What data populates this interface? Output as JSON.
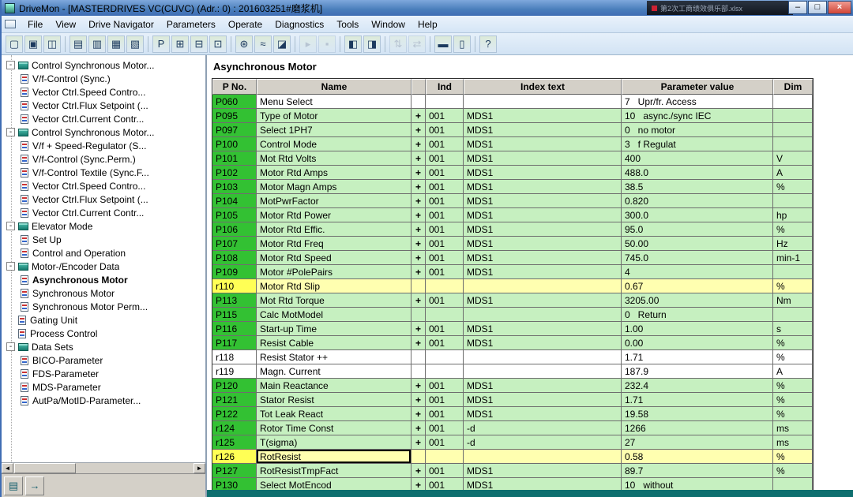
{
  "window": {
    "title": "DriveMon - [MASTERDRIVES VC(CUVC)  (Adr.: 0) : 201603251#磨浆机]",
    "overlay_text": "第2次工商绩效俱乐部.xlsx",
    "controls": {
      "minimize": "–",
      "maximize": "□",
      "close": "×"
    }
  },
  "menu": {
    "items": [
      "File",
      "View",
      "Drive Navigator",
      "Parameters",
      "Operate",
      "Diagnostics",
      "Tools",
      "Window",
      "Help"
    ]
  },
  "toolbar": {
    "icons": [
      {
        "name": "new-document-icon",
        "glyph": "▢"
      },
      {
        "name": "open-document-icon",
        "glyph": "▣"
      },
      {
        "name": "copy-documents-icon",
        "glyph": "◫"
      },
      {
        "name": "separator"
      },
      {
        "name": "parameter-form-icon",
        "glyph": "▤"
      },
      {
        "name": "script-form-icon",
        "glyph": "▥"
      },
      {
        "name": "print-icon",
        "glyph": "▦"
      },
      {
        "name": "print-preview-icon",
        "glyph": "▧"
      },
      {
        "name": "separator"
      },
      {
        "name": "parameter-overview-icon",
        "glyph": "P"
      },
      {
        "name": "parameter-grid-icon",
        "glyph": "⊞"
      },
      {
        "name": "parameter-quick-icon",
        "glyph": "⊟"
      },
      {
        "name": "parameter-compare-icon",
        "glyph": "⊡"
      },
      {
        "name": "separator"
      },
      {
        "name": "settings-gear-icon",
        "glyph": "⊛"
      },
      {
        "name": "trace-icon",
        "glyph": "≈"
      },
      {
        "name": "diagram-icon",
        "glyph": "◪"
      },
      {
        "name": "separator"
      },
      {
        "name": "drive-run-icon",
        "glyph": "▸",
        "disabled": true
      },
      {
        "name": "drive-stop-icon",
        "glyph": "▪",
        "disabled": true
      },
      {
        "name": "separator"
      },
      {
        "name": "table-view-icon",
        "glyph": "◧"
      },
      {
        "name": "window-view-icon",
        "glyph": "◨"
      },
      {
        "name": "separator"
      },
      {
        "name": "upread-parameters-icon",
        "glyph": "⇅",
        "disabled": true
      },
      {
        "name": "download-parameters-icon",
        "glyph": "⇄",
        "disabled": true
      },
      {
        "name": "separator"
      },
      {
        "name": "tile-horizontal-icon",
        "glyph": "▬"
      },
      {
        "name": "tile-vertical-icon",
        "glyph": "▯"
      },
      {
        "name": "separator"
      },
      {
        "name": "help-icon",
        "glyph": "?"
      }
    ]
  },
  "tree": {
    "collapse_glyph": "-",
    "items": [
      {
        "label": "Control Synchronous Motor...",
        "level": 1,
        "type": "book",
        "expanded": true
      },
      {
        "label": "V/f-Control (Sync.)",
        "level": 2,
        "type": "page"
      },
      {
        "label": "Vector Ctrl.Speed Contro...",
        "level": 2,
        "type": "page"
      },
      {
        "label": "Vector Ctrl.Flux Setpoint (...",
        "level": 2,
        "type": "page"
      },
      {
        "label": "Vector Ctrl.Current Contr...",
        "level": 2,
        "type": "page"
      },
      {
        "label": "Control Synchronous Motor...",
        "level": 1,
        "type": "book",
        "expanded": true
      },
      {
        "label": "V/f + Speed-Regulator (S...",
        "level": 2,
        "type": "page"
      },
      {
        "label": "V/f-Control (Sync.Perm.)",
        "level": 2,
        "type": "page"
      },
      {
        "label": "V/f-Control Textile (Sync.F...",
        "level": 2,
        "type": "page"
      },
      {
        "label": "Vector Ctrl.Speed Contro...",
        "level": 2,
        "type": "page"
      },
      {
        "label": "Vector Ctrl.Flux Setpoint (...",
        "level": 2,
        "type": "page"
      },
      {
        "label": "Vector Ctrl.Current Contr...",
        "level": 2,
        "type": "page"
      },
      {
        "label": "Elevator Mode",
        "level": 1,
        "type": "book",
        "expanded": true
      },
      {
        "label": "Set Up",
        "level": 2,
        "type": "page"
      },
      {
        "label": "Control and Operation",
        "level": 2,
        "type": "page"
      },
      {
        "label": "Motor-/Encoder Data",
        "level": 1,
        "type": "book",
        "expanded": true
      },
      {
        "label": "Asynchronous Motor",
        "level": 2,
        "type": "page",
        "selected": true
      },
      {
        "label": "Synchronous Motor",
        "level": 2,
        "type": "page"
      },
      {
        "label": "Synchronous Motor Perm...",
        "level": 2,
        "type": "page"
      },
      {
        "label": "Gating Unit",
        "level": 1,
        "type": "page"
      },
      {
        "label": "Process Control",
        "level": 1,
        "type": "page"
      },
      {
        "label": "Data Sets",
        "level": 1,
        "type": "book",
        "expanded": true
      },
      {
        "label": "BICO-Parameter",
        "level": 2,
        "type": "page"
      },
      {
        "label": "FDS-Parameter",
        "level": 2,
        "type": "page"
      },
      {
        "label": "MDS-Parameter",
        "level": 2,
        "type": "page"
      },
      {
        "label": "AutPa/MotID-Parameter...",
        "level": 2,
        "type": "page"
      }
    ],
    "scrollbar": {
      "left_arrow": "◄",
      "right_arrow": "►"
    },
    "bottom_icons": [
      {
        "name": "navigator-book-icon",
        "glyph": "▤"
      },
      {
        "name": "navigate-arrow-icon",
        "glyph": "→"
      }
    ]
  },
  "panel": {
    "title": "Asynchronous Motor"
  },
  "table": {
    "headers": [
      "P No.",
      "Name",
      "",
      "Ind",
      "Index text",
      "Parameter value",
      "Dim"
    ],
    "rows": [
      {
        "no": "P060",
        "name": "Menu Select",
        "plus": false,
        "ind": "",
        "index_text": "",
        "value": "7   Upr/fr. Access",
        "dim": "",
        "bg": "white",
        "no_bg": "green"
      },
      {
        "no": "P095",
        "name": "Type of Motor",
        "plus": true,
        "ind": "001",
        "index_text": "MDS1",
        "value": "10   async./sync IEC",
        "dim": "",
        "bg": "green",
        "no_bg": "green"
      },
      {
        "no": "P097",
        "name": "Select 1PH7",
        "plus": true,
        "ind": "001",
        "index_text": "MDS1",
        "value": "0   no motor",
        "dim": "",
        "bg": "green",
        "no_bg": "green"
      },
      {
        "no": "P100",
        "name": "Control Mode",
        "plus": true,
        "ind": "001",
        "index_text": "MDS1",
        "value": "3   f Regulat",
        "dim": "",
        "bg": "green",
        "no_bg": "green"
      },
      {
        "no": "P101",
        "name": "Mot Rtd Volts",
        "plus": true,
        "ind": "001",
        "index_text": "MDS1",
        "value": "400",
        "dim": "V",
        "bg": "green",
        "no_bg": "green"
      },
      {
        "no": "P102",
        "name": "Motor Rtd Amps",
        "plus": true,
        "ind": "001",
        "index_text": "MDS1",
        "value": "488.0",
        "dim": "A",
        "bg": "green",
        "no_bg": "green"
      },
      {
        "no": "P103",
        "name": "Motor Magn Amps",
        "plus": true,
        "ind": "001",
        "index_text": "MDS1",
        "value": "38.5",
        "dim": "%",
        "bg": "green",
        "no_bg": "green"
      },
      {
        "no": "P104",
        "name": "MotPwrFactor",
        "plus": true,
        "ind": "001",
        "index_text": "MDS1",
        "value": "0.820",
        "dim": "",
        "bg": "green",
        "no_bg": "green"
      },
      {
        "no": "P105",
        "name": "Motor Rtd Power",
        "plus": true,
        "ind": "001",
        "index_text": "MDS1",
        "value": "300.0",
        "dim": "hp",
        "bg": "green",
        "no_bg": "green"
      },
      {
        "no": "P106",
        "name": "Motor Rtd Effic.",
        "plus": true,
        "ind": "001",
        "index_text": "MDS1",
        "value": "95.0",
        "dim": "%",
        "bg": "green",
        "no_bg": "green"
      },
      {
        "no": "P107",
        "name": "Motor Rtd Freq",
        "plus": true,
        "ind": "001",
        "index_text": "MDS1",
        "value": "50.00",
        "dim": "Hz",
        "bg": "green",
        "no_bg": "green"
      },
      {
        "no": "P108",
        "name": "Motor Rtd Speed",
        "plus": true,
        "ind": "001",
        "index_text": "MDS1",
        "value": "745.0",
        "dim": "min-1",
        "bg": "green",
        "no_bg": "green"
      },
      {
        "no": "P109",
        "name": "Motor #PolePairs",
        "plus": true,
        "ind": "001",
        "index_text": "MDS1",
        "value": "4",
        "dim": "",
        "bg": "green",
        "no_bg": "green"
      },
      {
        "no": "r110",
        "name": "Motor Rtd Slip",
        "plus": false,
        "ind": "",
        "index_text": "",
        "value": "0.67",
        "dim": "%",
        "bg": "yellow",
        "no_bg": "yellow"
      },
      {
        "no": "P113",
        "name": "Mot Rtd Torque",
        "plus": true,
        "ind": "001",
        "index_text": "MDS1",
        "value": "3205.00",
        "dim": "Nm",
        "bg": "green",
        "no_bg": "green"
      },
      {
        "no": "P115",
        "name": "Calc MotModel",
        "plus": false,
        "ind": "",
        "index_text": "",
        "value": "0   Return",
        "dim": "",
        "bg": "green",
        "no_bg": "green"
      },
      {
        "no": "P116",
        "name": "Start-up Time",
        "plus": true,
        "ind": "001",
        "index_text": "MDS1",
        "value": "1.00",
        "dim": "s",
        "bg": "green",
        "no_bg": "green"
      },
      {
        "no": "P117",
        "name": "Resist Cable",
        "plus": true,
        "ind": "001",
        "index_text": "MDS1",
        "value": "0.00",
        "dim": "%",
        "bg": "green",
        "no_bg": "green"
      },
      {
        "no": "r118",
        "name": "Resist Stator ++",
        "plus": false,
        "ind": "",
        "index_text": "",
        "value": "1.71",
        "dim": "%",
        "bg": "white",
        "no_bg": "white"
      },
      {
        "no": "r119",
        "name": "Magn. Current",
        "plus": false,
        "ind": "",
        "index_text": "",
        "value": "187.9",
        "dim": "A",
        "bg": "white",
        "no_bg": "white"
      },
      {
        "no": "P120",
        "name": "Main Reactance",
        "plus": true,
        "ind": "001",
        "index_text": "MDS1",
        "value": "232.4",
        "dim": "%",
        "bg": "green",
        "no_bg": "green"
      },
      {
        "no": "P121",
        "name": "Stator Resist",
        "plus": true,
        "ind": "001",
        "index_text": "MDS1",
        "value": "1.71",
        "dim": "%",
        "bg": "green",
        "no_bg": "green"
      },
      {
        "no": "P122",
        "name": "Tot Leak React",
        "plus": true,
        "ind": "001",
        "index_text": "MDS1",
        "value": "19.58",
        "dim": "%",
        "bg": "green",
        "no_bg": "green"
      },
      {
        "no": "r124",
        "name": "Rotor Time Const",
        "plus": true,
        "ind": "001",
        "index_text": "-d",
        "value": "1266",
        "dim": "ms",
        "bg": "green",
        "no_bg": "green"
      },
      {
        "no": "r125",
        "name": "T(sigma)",
        "plus": true,
        "ind": "001",
        "index_text": "-d",
        "value": "27",
        "dim": "ms",
        "bg": "green",
        "no_bg": "green"
      },
      {
        "no": "r126",
        "name": "RotResist",
        "plus": false,
        "ind": "",
        "index_text": "",
        "value": "0.58",
        "dim": "%",
        "bg": "yellow",
        "no_bg": "yellow",
        "selected": true
      },
      {
        "no": "P127",
        "name": "RotResistTmpFact",
        "plus": true,
        "ind": "001",
        "index_text": "MDS1",
        "value": "89.7",
        "dim": "%",
        "bg": "green",
        "no_bg": "green"
      },
      {
        "no": "P130",
        "name": "Select MotEncod",
        "plus": true,
        "ind": "001",
        "index_text": "MDS1",
        "value": "10   without",
        "dim": "",
        "bg": "green",
        "no_bg": "green"
      }
    ]
  },
  "colors": {
    "parameter_green": "#33c133",
    "row_green": "#c6f0c0",
    "parameter_yellow": "#ffff55",
    "row_yellow": "#ffffb0",
    "header_grey": "#d4d0c8",
    "teal_accent": "#0e6f6f",
    "titlebar_blue": "#4a7ebb"
  }
}
